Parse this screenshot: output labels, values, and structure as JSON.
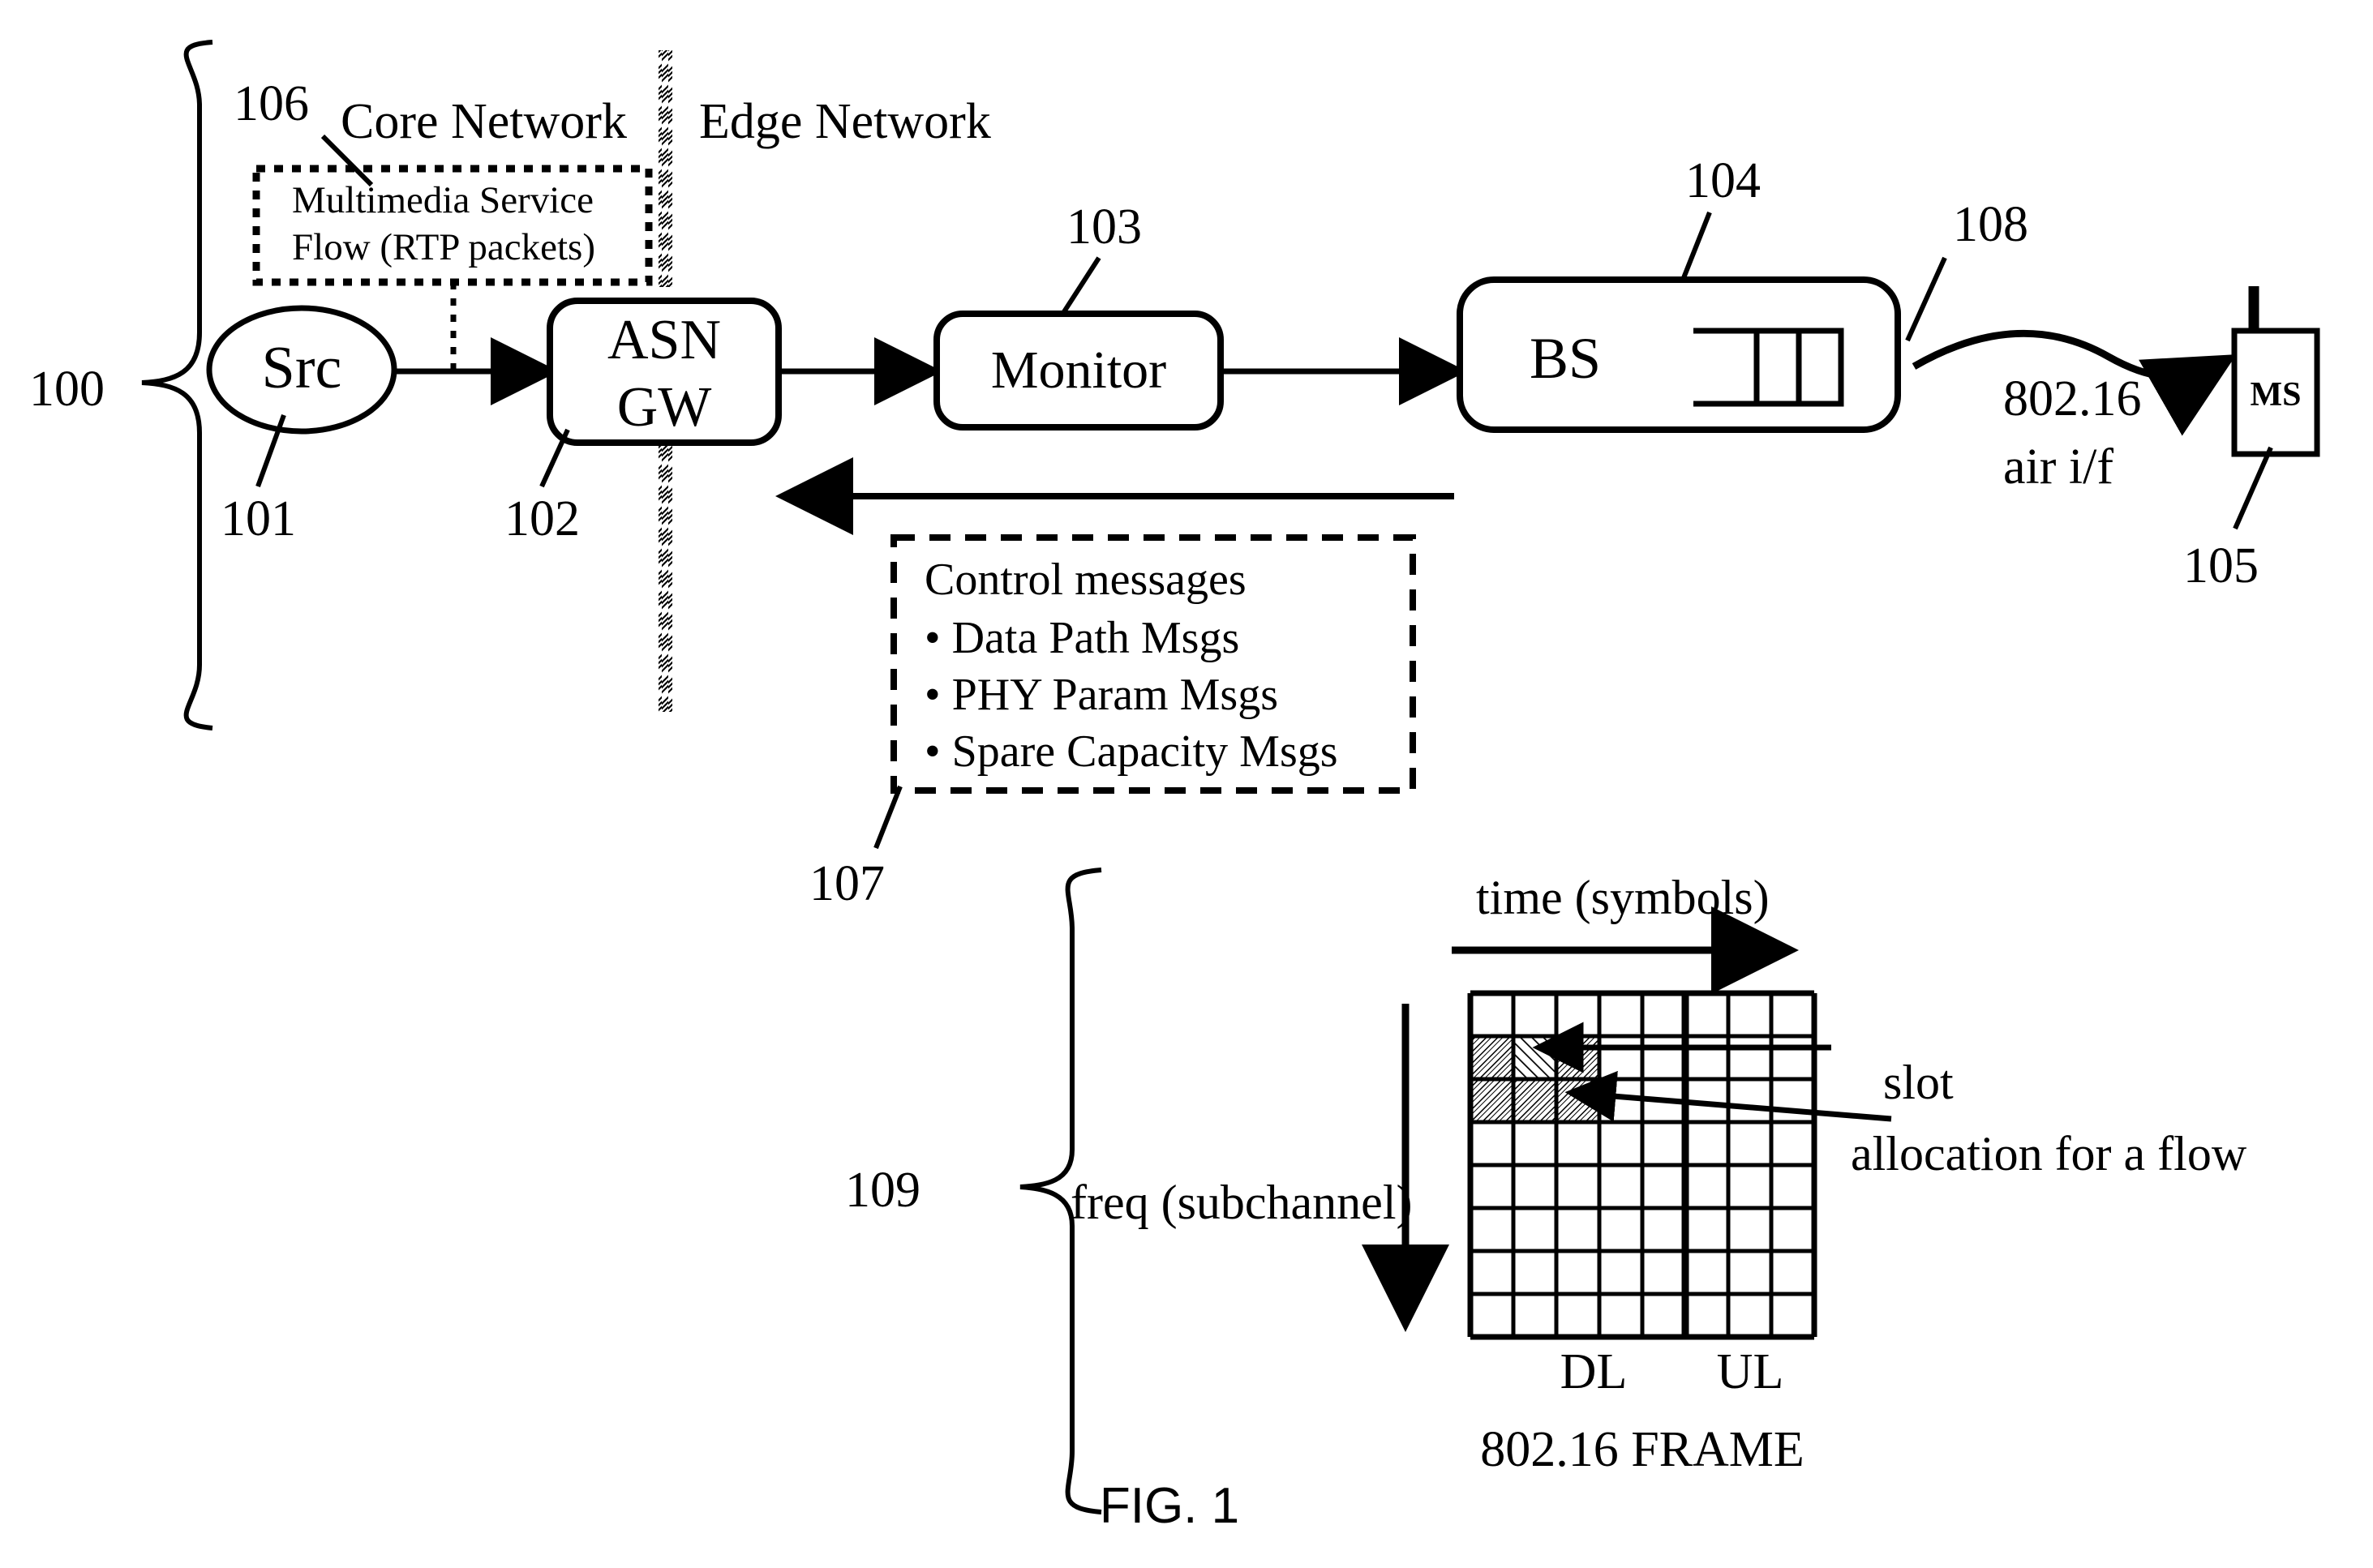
{
  "figure": {
    "caption": "FIG. 1",
    "type": "patent-diagram",
    "domains": {
      "core": "Core Network",
      "edge": "Edge Network"
    }
  },
  "nodes": {
    "src": "Src",
    "asn_gw_line1": "ASN",
    "asn_gw_line2": "GW",
    "monitor": "Monitor",
    "bs": "BS",
    "ms": "MS"
  },
  "annotations": {
    "multimedia_box_line1": "Multimedia Service",
    "multimedia_box_line2": "Flow (RTP packets)",
    "air_if_line1": "802.16",
    "air_if_line2": "air i/f",
    "control_title": "Control messages",
    "control_items": [
      "• Data Path Msgs",
      "• PHY Param Msgs",
      "• Spare Capacity Msgs"
    ]
  },
  "frame": {
    "time_axis_label": "time (symbols)",
    "freq_axis_label": "freq (subchannel)",
    "dl_label": "DL",
    "ul_label": "UL",
    "frame_title": "802.16 FRAME",
    "slot_label": "slot",
    "allocation_label": "allocation for a flow"
  },
  "reference_numerals": {
    "n100": "100",
    "n101": "101",
    "n102": "102",
    "n103": "103",
    "n104": "104",
    "n105": "105",
    "n106": "106",
    "n107": "107",
    "n108": "108",
    "n109": "109"
  },
  "chart_data": {
    "type": "heatmap",
    "title": "802.16 FRAME",
    "xlabel": "time (symbols)",
    "ylabel": "freq (subchannel)",
    "columns": 8,
    "rows": 8,
    "dl_columns": [
      1,
      2,
      3,
      4,
      5
    ],
    "ul_columns": [
      6,
      7,
      8
    ],
    "shaded_cells": [
      {
        "row": 2,
        "col": 1
      },
      {
        "row": 2,
        "col": 2
      },
      {
        "row": 2,
        "col": 3
      },
      {
        "row": 3,
        "col": 1
      },
      {
        "row": 3,
        "col": 2
      },
      {
        "row": 3,
        "col": 3
      }
    ],
    "legend": [
      "slot",
      "allocation for a flow"
    ]
  },
  "colors": {
    "ink": "#000000",
    "paper": "#ffffff",
    "hatch": "#000000"
  }
}
